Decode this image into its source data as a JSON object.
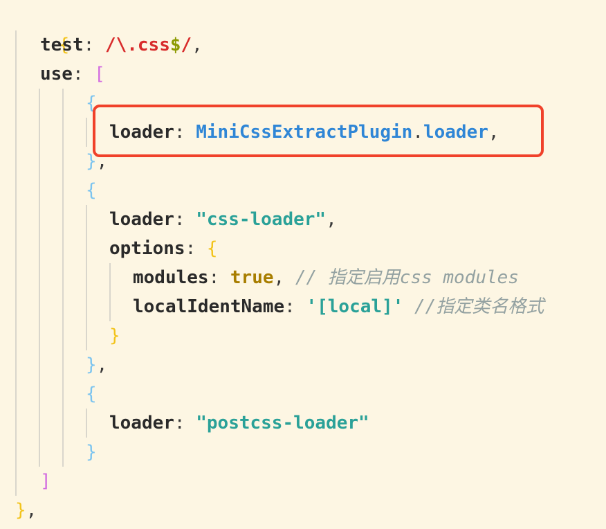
{
  "editor": {
    "lines": {
      "l1": {
        "brace": "{"
      },
      "l2": {
        "key": "test",
        "colon": ": ",
        "regex_a": "/\\.css",
        "regex_dollar": "$",
        "regex_b": "/",
        "comma": ","
      },
      "l3": {
        "key": "use",
        "colon": ": ",
        "bracket": "["
      },
      "l4": {
        "brace": "{"
      },
      "l5": {
        "key": "loader",
        "colon": ": ",
        "ident_a": "MiniCssExtractPlugin",
        "dot": ".",
        "ident_b": "loader",
        "comma": ","
      },
      "l6": {
        "brace": "}",
        "comma": ","
      },
      "l7": {
        "brace": "{"
      },
      "l8": {
        "key": "loader",
        "colon": ": ",
        "string": "\"css-loader\"",
        "comma": ","
      },
      "l9": {
        "key": "options",
        "colon": ": ",
        "brace": "{"
      },
      "l10": {
        "key": "modules",
        "colon": ": ",
        "value": "true",
        "comma": ",",
        "comment": " // 指定启用css modules"
      },
      "l11": {
        "key": "localIdentName",
        "colon": ": ",
        "string": "'[local]'",
        "comment": " //指定类名格式"
      },
      "l12": {
        "brace": "}"
      },
      "l13": {
        "brace": "}",
        "comma": ","
      },
      "l14": {
        "brace": "{"
      },
      "l15": {
        "key": "loader",
        "colon": ": ",
        "string": "\"postcss-loader\""
      },
      "l16": {
        "brace": "}"
      },
      "l17": {
        "bracket": "]"
      },
      "l18": {
        "brace": "}",
        "comma": ","
      }
    },
    "colors": {
      "background": "#fdf6e3",
      "highlight_border": "#f0412a",
      "regex": "#d82b2b",
      "identifier": "#2f86d6",
      "string": "#2aa198",
      "boolean": "#a87e00",
      "comment": "#93a1a1"
    }
  }
}
